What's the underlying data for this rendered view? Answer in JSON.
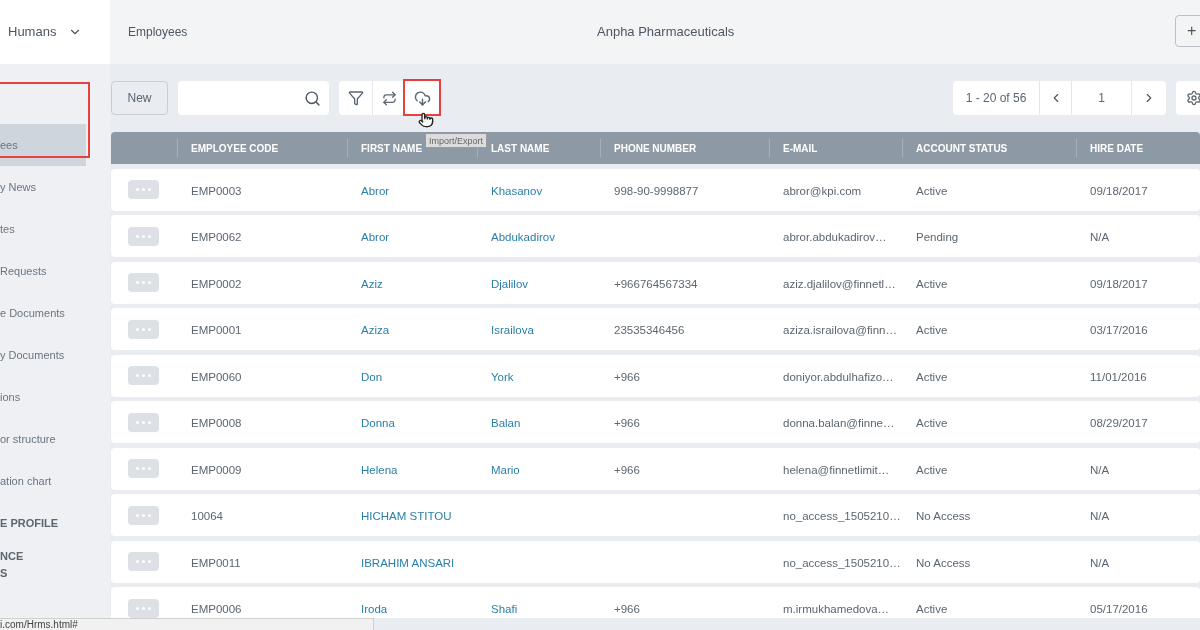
{
  "app_switcher": {
    "label": "Humans"
  },
  "breadcrumb": "Employees",
  "company": "Anpha Pharmaceuticals",
  "add_button": "+",
  "sidebar": {
    "items": [
      {
        "kind": "link",
        "label": "ees",
        "selected": true
      },
      {
        "kind": "link",
        "label": "y News",
        "selected": false
      },
      {
        "kind": "link",
        "label": "tes",
        "selected": false
      },
      {
        "kind": "link",
        "label": "Requests",
        "selected": false
      },
      {
        "kind": "link",
        "label": "e Documents",
        "selected": false
      },
      {
        "kind": "link",
        "label": "y Documents",
        "selected": false
      },
      {
        "kind": "link",
        "label": "ions",
        "selected": false
      },
      {
        "kind": "link",
        "label": "or structure",
        "selected": false
      },
      {
        "kind": "link",
        "label": "ation chart",
        "selected": false
      },
      {
        "kind": "section",
        "label": "E PROFILE",
        "selected": false
      },
      {
        "kind": "section",
        "label": "NCE\nS",
        "selected": false
      }
    ]
  },
  "toolbar": {
    "new_button": "New",
    "tooltip": "Import/Export"
  },
  "pagination": {
    "range": "1 - 20 of 56",
    "page": "1"
  },
  "table": {
    "columns": [
      "EMPLOYEE CODE",
      "FIRST NAME",
      "LAST NAME",
      "PHONE NUMBER",
      "E-MAIL",
      "ACCOUNT STATUS",
      "HIRE DATE"
    ],
    "rows": [
      [
        "EMP0003",
        "Abror",
        "Khasanov",
        "998-90-9998877",
        "abror@kpi.com",
        "Active",
        "09/18/2017"
      ],
      [
        "EMP0062",
        "Abror",
        "Abdukadirov",
        "",
        "abror.abdukadirov…",
        "Pending",
        "N/A"
      ],
      [
        "EMP0002",
        "Aziz",
        "Djalilov",
        "+966764567334",
        "aziz.djalilov@finnetl…",
        "Active",
        "09/18/2017"
      ],
      [
        "EMP0001",
        "Aziza",
        "Israilova",
        "23535346456",
        "aziza.israilova@finn…",
        "Active",
        "03/17/2016"
      ],
      [
        "EMP0060",
        "Don",
        "York",
        "+966",
        "doniyor.abdulhafizo…",
        "Active",
        "11/01/2016"
      ],
      [
        "EMP0008",
        "Donna",
        "Balan",
        "+966",
        "donna.balan@finne…",
        "Active",
        "08/29/2017"
      ],
      [
        "EMP0009",
        "Helena",
        "Mario",
        "+966",
        "helena@finnetlimit…",
        "Active",
        "N/A"
      ],
      [
        "10064",
        "HICHAM STITOU",
        "",
        "",
        "no_access_1505210…",
        "No Access",
        "N/A"
      ],
      [
        "EMP0011",
        "IBRAHIM ANSARI",
        "",
        "",
        "no_access_1505210…",
        "No Access",
        "N/A"
      ],
      [
        "EMP0006",
        "Iroda",
        "Shafi",
        "+966",
        "m.irmukhamedova…",
        "Active",
        "05/17/2016"
      ]
    ]
  },
  "status_bar": "i.com/Hrms.html#"
}
